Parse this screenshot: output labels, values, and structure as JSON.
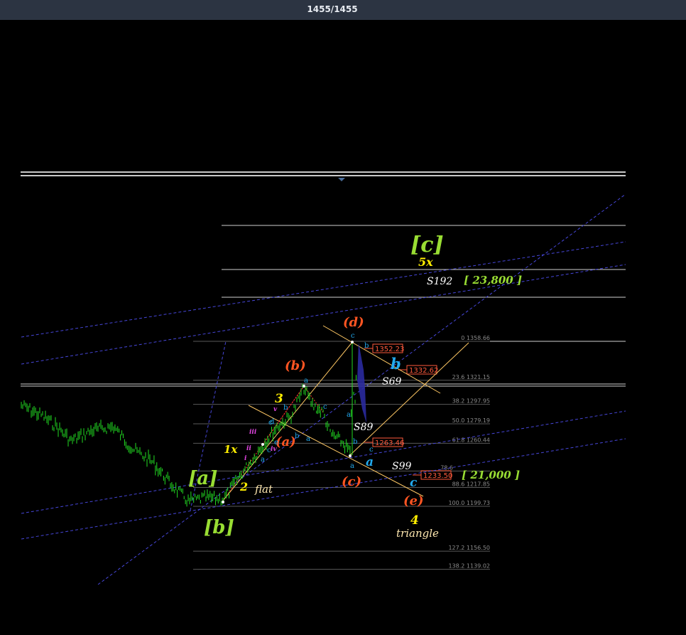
{
  "header": {
    "counter": "1455/1455"
  },
  "chart_data": {
    "type": "line",
    "title": "",
    "xlabel": "",
    "ylabel": "",
    "ylim": [
      1100,
      1480
    ],
    "price_series": [
      1265,
      1262,
      1254,
      1250,
      1245,
      1236,
      1226,
      1216,
      1207,
      1199,
      1203,
      1211,
      1218,
      1231,
      1243,
      1251,
      1258,
      1262,
      1266,
      1270,
      1275,
      1284,
      1292,
      1299,
      1305,
      1312,
      1298,
      1288,
      1276,
      1269,
      1263,
      1256,
      1259,
      1266,
      1274,
      1281,
      1290,
      1298,
      1306,
      1313,
      1320,
      1327,
      1334,
      1341,
      1348,
      1355,
      1351,
      1344,
      1336,
      1326,
      1314,
      1300,
      1288,
      1276,
      1266,
      1263,
      1281,
      1300,
      1320,
      1340,
      1359,
      1346,
      1333
    ],
    "price_label_count": 63,
    "fib_levels": [
      {
        "ratio": "0",
        "price": "1358.66"
      },
      {
        "ratio": "23.6",
        "price": "1321.15"
      },
      {
        "ratio": "38.2",
        "price": "1297.95"
      },
      {
        "ratio": "50.0",
        "price": "1279.19"
      },
      {
        "ratio": "61.8",
        "price": "1260.44"
      },
      {
        "ratio": "78.6",
        "price": ""
      },
      {
        "ratio": "88.6",
        "price": "1217.85"
      },
      {
        "ratio": "100.0",
        "price": "1199.73"
      },
      {
        "ratio": "127.2",
        "price": "1156.50"
      },
      {
        "ratio": "138.2",
        "price": "1139.02"
      }
    ],
    "price_tags": [
      "1352.23",
      "1332.62",
      "1263.46",
      "1233.50"
    ],
    "wave_labels": {
      "c_big": "[c]",
      "five_x": "5x",
      "d": "(d)",
      "b_paren": "(b)",
      "a_paren": "(a)",
      "c_paren": "(c)",
      "e_paren": "(e)",
      "a_big": "[a]",
      "b_big": "[b]",
      "three": "3",
      "one_x": "1x",
      "two": "2",
      "flat": "flat",
      "four": "4",
      "triangle": "triangle",
      "b_blue": "b",
      "a_blue": "a",
      "c_blue": "c",
      "iii": "iii",
      "ii": "ii",
      "i_lbl": "i",
      "iv": "iv",
      "v": "v"
    },
    "annotations": {
      "s192": "S192",
      "s69": "S69",
      "s89": "S89",
      "s99": "S99",
      "target_high": "[ 23,800 ]",
      "target_low": "[ 21,000 ]"
    },
    "small_letters": [
      "c",
      "a",
      "b",
      "c",
      "b",
      "a",
      "c",
      "b",
      "a",
      "d",
      "e",
      "a",
      "c",
      "b",
      "a",
      "c"
    ]
  },
  "colors": {
    "background": "#000000",
    "price": "#22dd22",
    "hline": "#d0d0d0",
    "channel": "#4646d8",
    "fib": "#ffc864",
    "wave_green": "#99dd33",
    "wave_orange": "#ff5522",
    "wave_yellow": "#ffee00",
    "wave_blue": "#22aaee"
  }
}
